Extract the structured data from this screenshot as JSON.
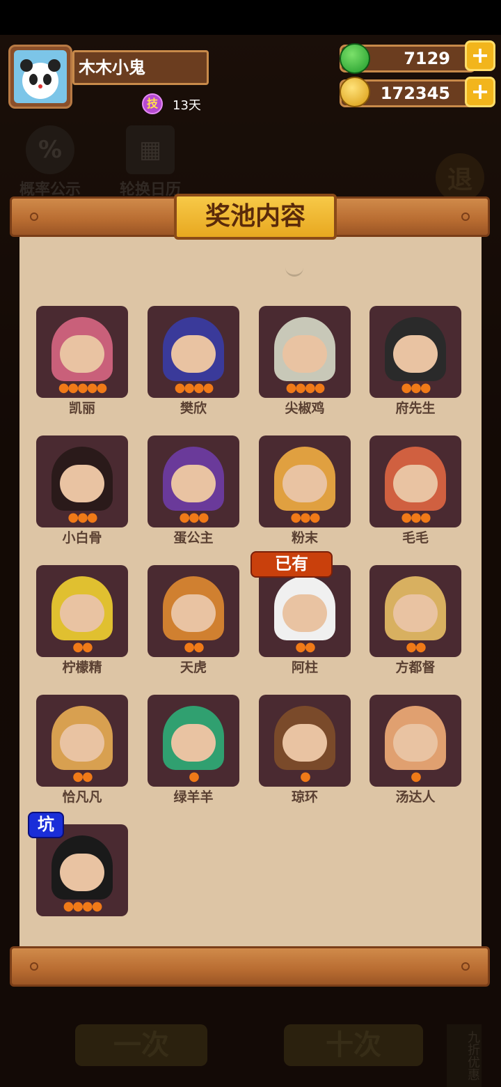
{
  "player": {
    "name": "木木小鬼",
    "skill_badge": "技",
    "days": "13天"
  },
  "resources": {
    "jade": "7129",
    "coins": "172345",
    "plus_label": "+"
  },
  "background": {
    "probability_label": "概率公示",
    "calendar_label": "轮换日历",
    "exit_label": "退",
    "single_draw_label": "一次",
    "ten_draw_label": "十次",
    "discount_label": "九折优惠"
  },
  "panel": {
    "title": "奖池内容",
    "tag_owned": "已有",
    "tag_pit": "坑",
    "characters": [
      {
        "name": "凯丽",
        "stars": 5,
        "color": "#c9607a"
      },
      {
        "name": "樊欣",
        "stars": 4,
        "color": "#3a3a9a"
      },
      {
        "name": "尖椒鸡",
        "stars": 4,
        "color": "#c8c8b8"
      },
      {
        "name": "府先生",
        "stars": 3,
        "color": "#2a2a2a"
      },
      {
        "name": "小白骨",
        "stars": 3,
        "color": "#2a1a1a"
      },
      {
        "name": "蛋公主",
        "stars": 3,
        "color": "#6a3a9a"
      },
      {
        "name": "粉末",
        "stars": 3,
        "color": "#e0a040"
      },
      {
        "name": "毛毛",
        "stars": 3,
        "color": "#d06040"
      },
      {
        "name": "柠檬精",
        "stars": 2,
        "color": "#e0c030"
      },
      {
        "name": "天虎",
        "stars": 2,
        "color": "#d08030"
      },
      {
        "name": "阿柱",
        "stars": 2,
        "color": "#f0f0f0",
        "owned": true
      },
      {
        "name": "方都督",
        "stars": 2,
        "color": "#d8b060"
      },
      {
        "name": "恰凡凡",
        "stars": 2,
        "color": "#d8a050"
      },
      {
        "name": "绿羊羊",
        "stars": 1,
        "color": "#30a070"
      },
      {
        "name": "琼环",
        "stars": 1,
        "color": "#7a4a2a"
      },
      {
        "name": "汤达人",
        "stars": 1,
        "color": "#e0a070"
      },
      {
        "name": "",
        "stars": 4,
        "color": "#1a1a1a",
        "pit": true
      }
    ]
  },
  "colors": {
    "panel_bg": "#ddc5a5",
    "card_bg": "#4a2a31",
    "accent_gold": "#f2b51c",
    "owned_red": "#c9400c",
    "pit_blue": "#1a2ed8"
  }
}
